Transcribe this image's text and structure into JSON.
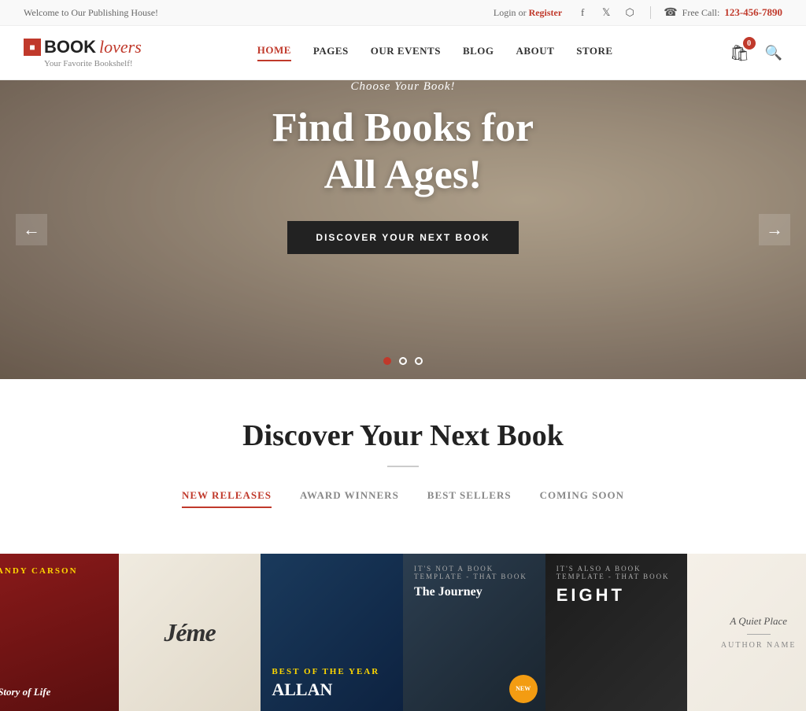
{
  "topbar": {
    "welcome": "Welcome to Our Publishing House!",
    "login": "Login",
    "or": " or ",
    "register": "Register",
    "free_call_label": "Free Call:",
    "phone": "123-456-7890",
    "social": [
      "f",
      "𝕏",
      "📷"
    ]
  },
  "header": {
    "logo_book": "BOOK",
    "logo_lovers": "lovers",
    "tagline": "Your Favorite Bookshelf!",
    "nav": [
      {
        "label": "HOME",
        "active": true
      },
      {
        "label": "PAGES",
        "active": false
      },
      {
        "label": "OUR EVENTS",
        "active": false
      },
      {
        "label": "BLOG",
        "active": false
      },
      {
        "label": "ABOUT",
        "active": false
      },
      {
        "label": "STORE",
        "active": false
      }
    ],
    "cart_count": "0"
  },
  "hero": {
    "subtitle": "Choose Your Book!",
    "title": "Find Books for\nAll Ages!",
    "cta": "DISCOVER YOUR NEXT BOOK",
    "dots": 3
  },
  "discover": {
    "title": "Discover Your Next Book",
    "tabs": [
      {
        "label": "NEW RELEASES",
        "active": true
      },
      {
        "label": "AWARD WINNERS",
        "active": false
      },
      {
        "label": "BEST SELLERS",
        "active": false
      },
      {
        "label": "COMING SOON",
        "active": false
      }
    ]
  },
  "books": [
    {
      "id": 1,
      "author": "CANDY CARSON",
      "title": "",
      "style": "book-1",
      "badge": false
    },
    {
      "id": 2,
      "author": "",
      "title": "",
      "style": "book-2",
      "badge": false
    },
    {
      "id": 3,
      "author": "ALLAN",
      "title": "",
      "style": "book-3",
      "badge": false
    },
    {
      "id": 4,
      "author": "",
      "title": "",
      "style": "book-4",
      "badge": true,
      "badge_text": "NEW"
    },
    {
      "id": 5,
      "author": "",
      "title": "",
      "style": "book-5",
      "badge": false
    },
    {
      "id": 6,
      "author": "",
      "title": "",
      "style": "book-6",
      "badge": false
    }
  ]
}
